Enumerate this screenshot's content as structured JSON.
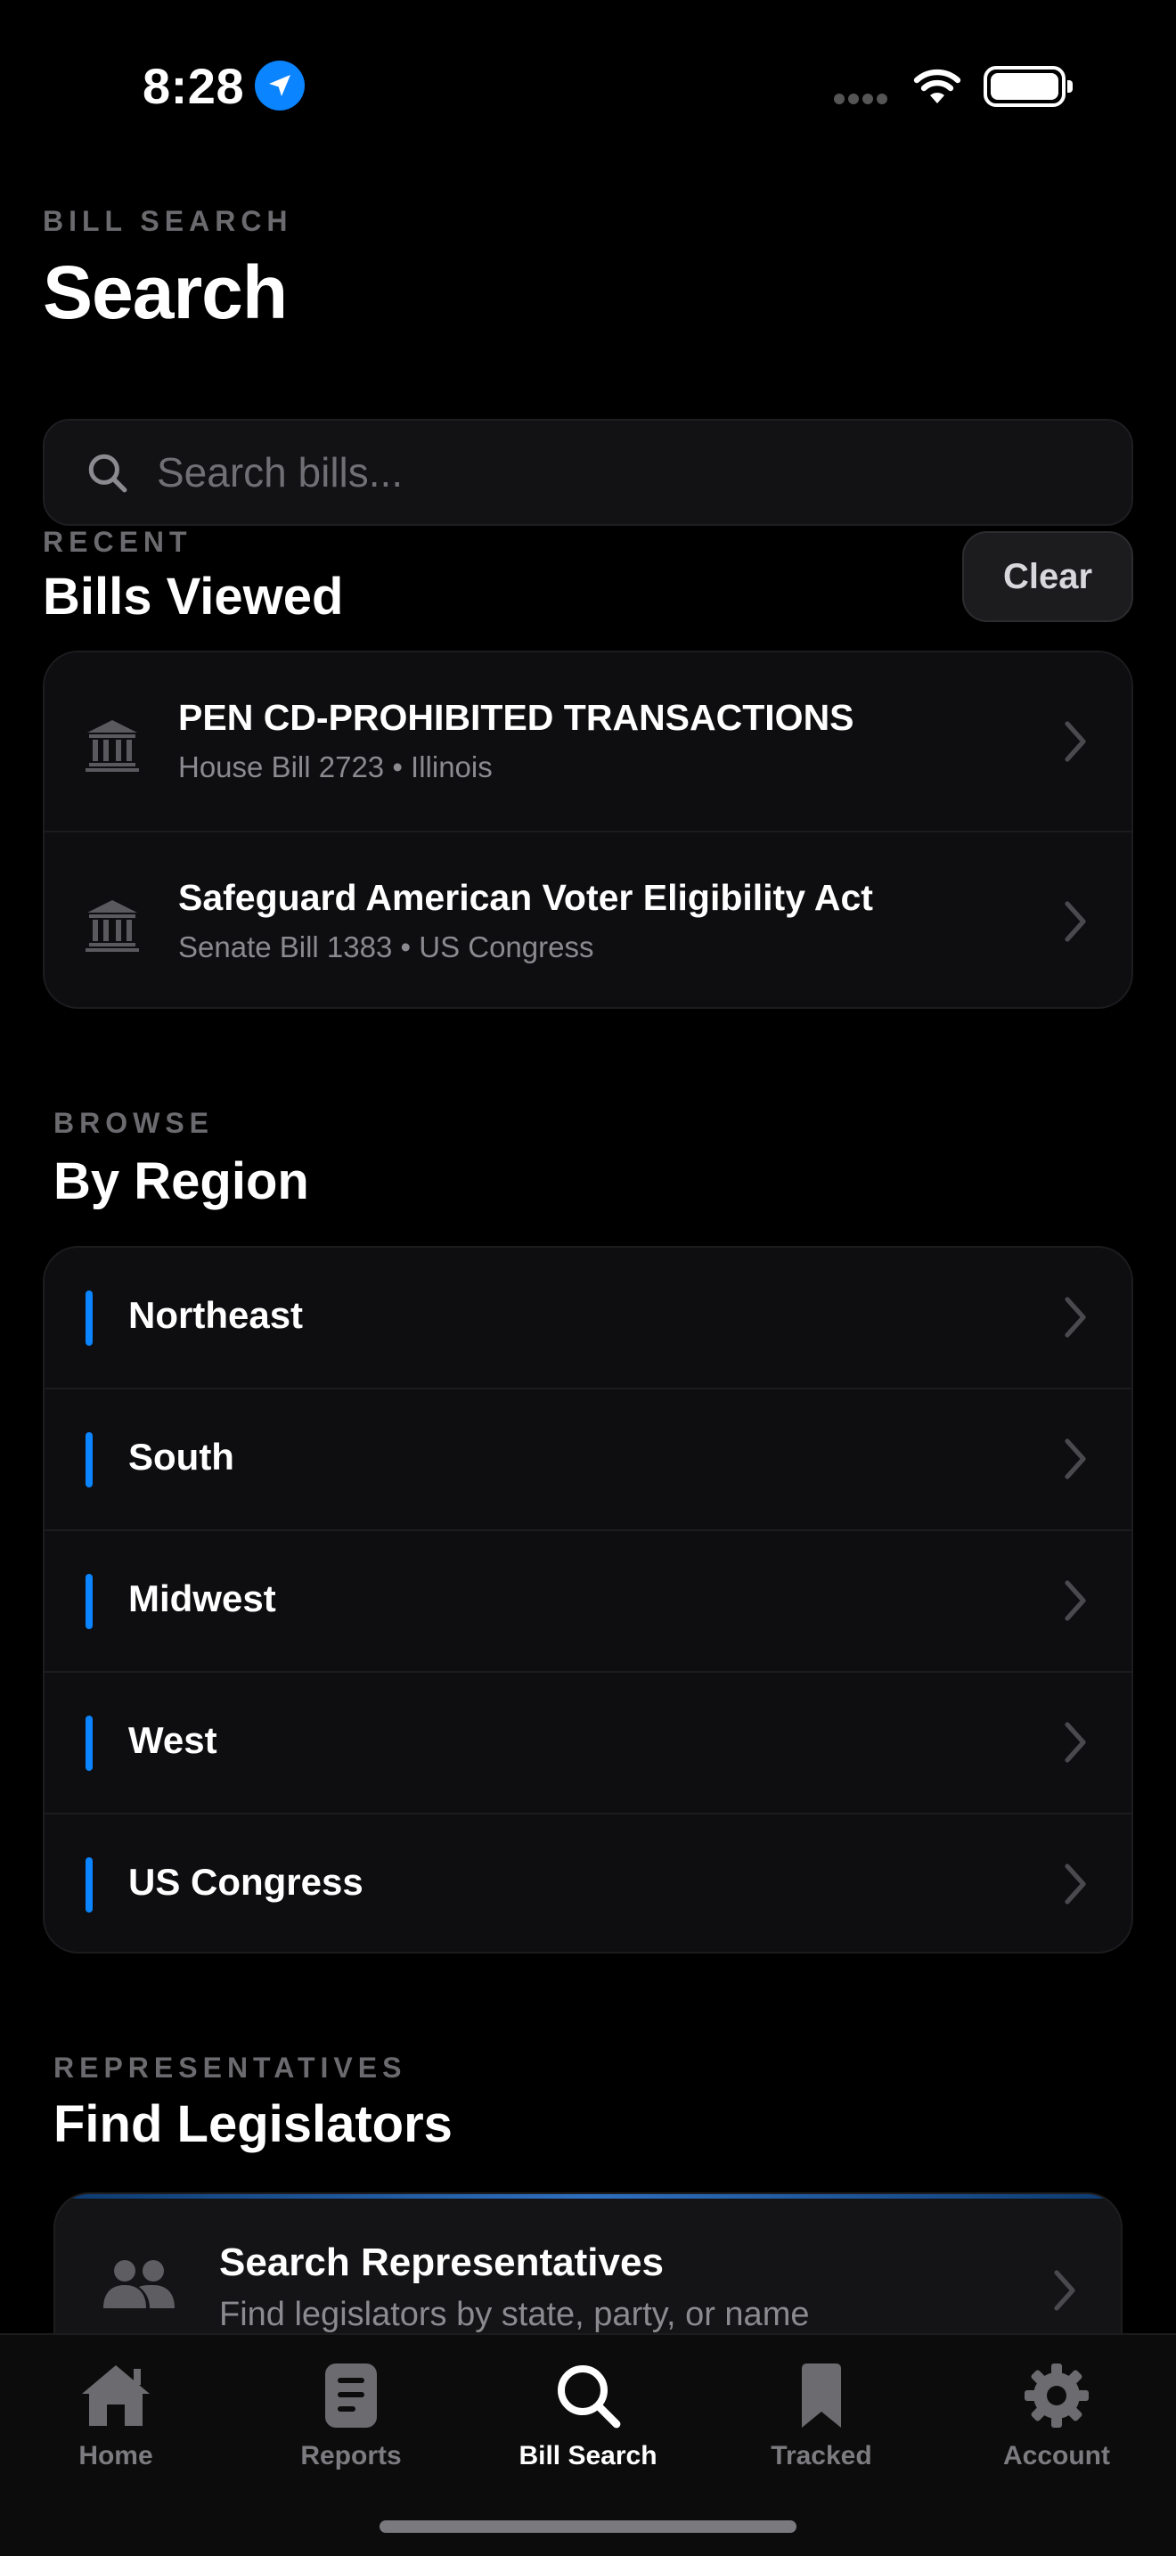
{
  "status_bar": {
    "time": "8:28"
  },
  "header": {
    "eyebrow": "BILL SEARCH",
    "title": "Search"
  },
  "search": {
    "placeholder": "Search bills..."
  },
  "recent": {
    "eyebrow": "RECENT",
    "title": "Bills Viewed",
    "clear_label": "Clear",
    "items": [
      {
        "title": "PEN CD-PROHIBITED TRANSACTIONS",
        "subtitle": "House Bill 2723 • Illinois",
        "icon": "bank-icon"
      },
      {
        "title": "Safeguard American Voter Eligibility Act",
        "subtitle": "Senate Bill 1383 • US Congress",
        "icon": "bank-icon"
      }
    ]
  },
  "browse": {
    "eyebrow": "BROWSE",
    "title": "By Region",
    "accent_color": "#0a84ff",
    "regions": [
      {
        "label": "Northeast"
      },
      {
        "label": "South"
      },
      {
        "label": "Midwest"
      },
      {
        "label": "West"
      },
      {
        "label": "US Congress"
      }
    ]
  },
  "representatives": {
    "eyebrow": "REPRESENTATIVES",
    "title": "Find Legislators",
    "card_title": "Search Representatives",
    "card_subtitle": "Find legislators by state, party, or name",
    "icon": "people-icon"
  },
  "tab_bar": {
    "tabs": [
      {
        "label": "Home",
        "icon": "home-icon",
        "active": false
      },
      {
        "label": "Reports",
        "icon": "document-icon",
        "active": false
      },
      {
        "label": "Bill Search",
        "icon": "search-icon",
        "active": true
      },
      {
        "label": "Tracked",
        "icon": "bookmark-icon",
        "active": false
      },
      {
        "label": "Account",
        "icon": "gear-icon",
        "active": false
      }
    ]
  }
}
